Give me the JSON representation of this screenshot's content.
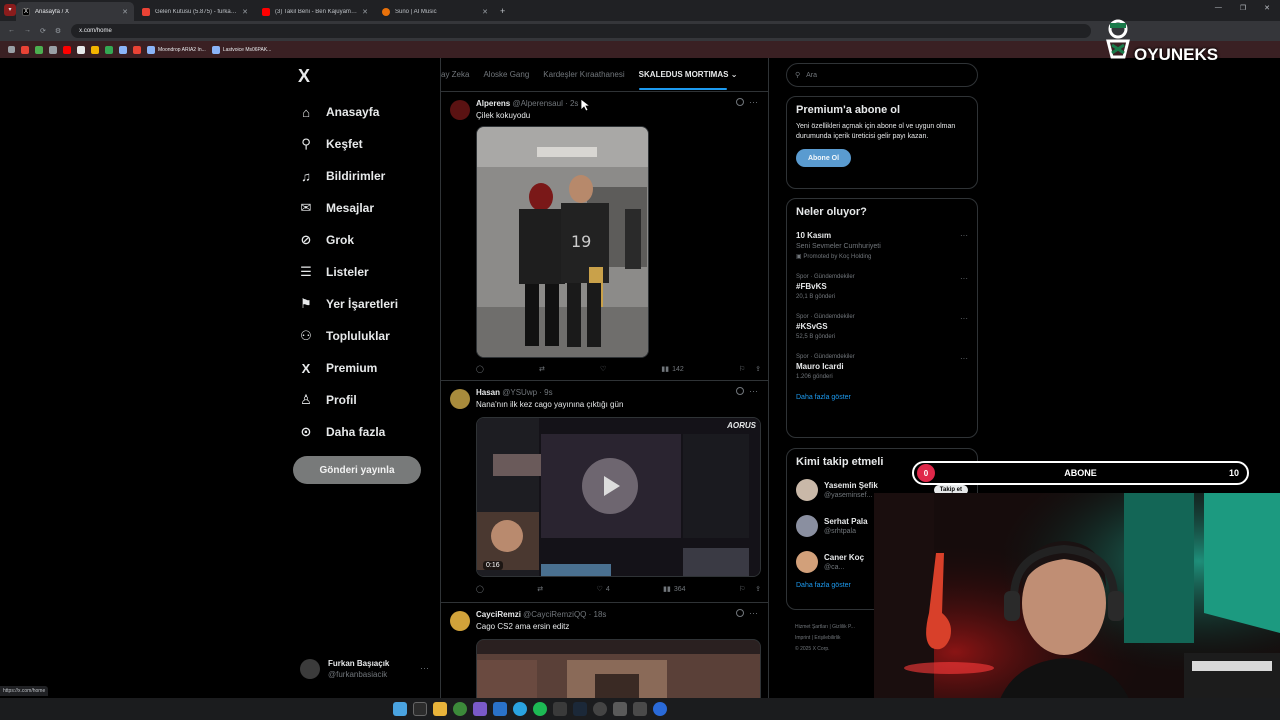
{
  "browser": {
    "tabs": [
      {
        "label": "Anasayfa / X",
        "color": "#e7e9ea",
        "active": true
      },
      {
        "label": "Gelen Kutusu (5.875) - furkanb...",
        "color": "#ea4335",
        "active": false
      },
      {
        "label": "(3) Takıl Beni - Ben Kajuyam Ka...",
        "color": "#ff0000",
        "active": false
      },
      {
        "label": "Suno | AI Music",
        "color": "#e8710a",
        "active": false
      }
    ],
    "new_tab": "+",
    "url": "x.com/home",
    "bookmarks": [
      {
        "label": "",
        "color": "#ea4335"
      },
      {
        "label": "",
        "color": "#4caf50"
      },
      {
        "label": "",
        "color": "#9aa0a6"
      },
      {
        "label": "",
        "color": "#ff0000"
      },
      {
        "label": "",
        "color": "#e7e9ea"
      },
      {
        "label": "",
        "color": "#f4b400"
      },
      {
        "label": "",
        "color": "#34a853"
      },
      {
        "label": "Moondrop ARIA2 In...",
        "color": "#8ab4f8"
      },
      {
        "label": "Lastvoice Ms06PAK...",
        "color": "#8ab4f8"
      }
    ],
    "status_url": "https://x.com/home"
  },
  "sidebar": {
    "logo": "X",
    "items": [
      {
        "label": "Anasayfa",
        "icon": "home-icon",
        "glyph": "⌂"
      },
      {
        "label": "Keşfet",
        "icon": "search-icon",
        "glyph": "⚲"
      },
      {
        "label": "Bildirimler",
        "icon": "bell-icon",
        "glyph": "🔔"
      },
      {
        "label": "Mesajlar",
        "icon": "mail-icon",
        "glyph": "✉"
      },
      {
        "label": "Grok",
        "icon": "grok-icon",
        "glyph": "⊘"
      },
      {
        "label": "Listeler",
        "icon": "list-icon",
        "glyph": "☰"
      },
      {
        "label": "Yer İşaretleri",
        "icon": "bookmark-icon",
        "glyph": "⚑"
      },
      {
        "label": "Topluluklar",
        "icon": "communities-icon",
        "glyph": "⚇"
      },
      {
        "label": "Premium",
        "icon": "x-premium-icon",
        "glyph": "X"
      },
      {
        "label": "Profil",
        "icon": "profile-icon",
        "glyph": "♙"
      },
      {
        "label": "Daha fazla",
        "icon": "more-circle-icon",
        "glyph": "⋯"
      }
    ],
    "post_button": "Gönderi yayınla",
    "account": {
      "name": "Furkan Başıaçık",
      "handle": "@furkanbasiacik"
    }
  },
  "timeline": {
    "tabs": [
      "ay Zeka",
      "Aloske Gang",
      "Kardeşler Kıraathanesi",
      "SKALEDUS MORTIMAS"
    ],
    "active_tab_index": 3,
    "tweets": [
      {
        "name": "Alperens",
        "handle": "@Alperensaul · 2s",
        "text": "Çilek kokuyodu",
        "avatar_color": "#5a1212",
        "views": "142",
        "likes": "",
        "retweets": "",
        "replies": ""
      },
      {
        "name": "Hasan",
        "handle": "@YSUwp · 9s",
        "text": "Nana'nın ilk kez cago yayınına çıktığı gün",
        "avatar_color": "#a88b3c",
        "views": "364",
        "likes": "4",
        "retweets": "",
        "replies": "",
        "video_time": "0:16",
        "watermark": "AORUS"
      },
      {
        "name": "CayciRemzi",
        "handle": "@CayciRemziQQ · 18s",
        "text": "Cago CS2 ama ersin editz",
        "avatar_color": "#d1a23a",
        "views": "",
        "likes": "",
        "retweets": "",
        "replies": ""
      }
    ]
  },
  "right": {
    "search_placeholder": "Ara",
    "premium": {
      "title": "Premium'a abone ol",
      "text": "Yeni özellikleri açmak için abone ol ve uygun olman durumunda içerik üreticisi gelir payı kazan.",
      "button": "Abone Ol"
    },
    "trends": {
      "title": "Neler oluyor?",
      "items": [
        {
          "context": "",
          "title": "10 Kasım",
          "sub": "Seni Sevmeler Cumhuriyeti",
          "promo": "Promoted by Koç Holding"
        },
        {
          "context": "Spor · Gündemdekiler",
          "title": "#FBvKS",
          "sub": "20,1 B gönderi",
          "promo": ""
        },
        {
          "context": "Spor · Gündemdekiler",
          "title": "#KSvGS",
          "sub": "52,5 B gönderi",
          "promo": ""
        },
        {
          "context": "Spor · Gündemdekiler",
          "title": "Mauro Icardi",
          "sub": "1.206 gönderi",
          "promo": ""
        }
      ],
      "show_more": "Daha fazla göster"
    },
    "who_to_follow": {
      "title": "Kimi takip etmeli",
      "items": [
        {
          "name": "Yasemin Şefik",
          "handle": "@yaseminsef...",
          "color": "#c9b8a8"
        },
        {
          "name": "Serhat Pala",
          "handle": "@srhtpala",
          "color": "#8a8fa0"
        },
        {
          "name": "Caner Koç",
          "handle": "@ca...",
          "color": "#d2a07a"
        }
      ],
      "follow_label": "Takip et",
      "show_more": "Daha fazla göster"
    },
    "footer": [
      "Hizmet Şartları",
      "Gizlilik P...",
      "Imprint",
      "Erişilebilirlik",
      "© 2025 X Corp."
    ]
  },
  "overlay": {
    "brand": "OYUNEKS",
    "sub_goal": {
      "label": "ABONE",
      "current": "0",
      "target": "10",
      "progress": 0
    }
  }
}
